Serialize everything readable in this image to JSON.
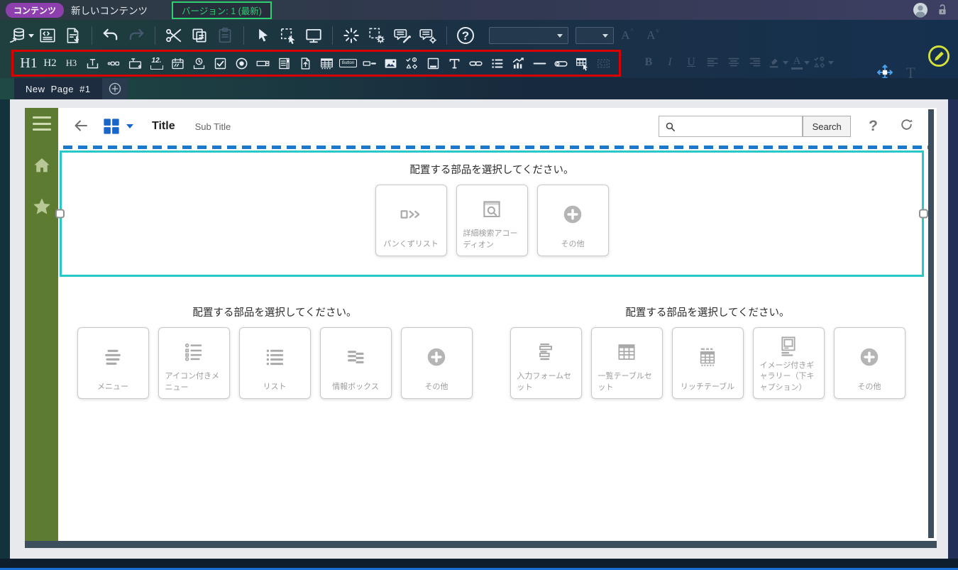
{
  "topbar": {
    "content_badge": "コンテンツ",
    "document_title": "新しいコンテンツ",
    "version_badge": "バージョン: 1 (最新)"
  },
  "toolbar": {
    "help_glyph": "?",
    "font_increase_letter": "A",
    "font_decrease_letter": "A",
    "move_tool_letter": "T"
  },
  "component_palette": {
    "h1": "H1",
    "h2": "H2",
    "h3": "H3",
    "number_label": "12.",
    "button_label": "Button",
    "text_letter": "T"
  },
  "formatting": {
    "bold": "B",
    "italic": "I",
    "underline": "U",
    "font_color_letter": "A"
  },
  "tabbar": {
    "page_tab_label": "New Page #1"
  },
  "page_header": {
    "title": "Title",
    "subtitle": "Sub Title",
    "search_placeholder": "",
    "search_button_label": "Search",
    "help_glyph": "?"
  },
  "placement_prompt": "配置する部品を選択してください。",
  "sections": {
    "hero": {
      "cards": [
        {
          "label": "パンくずリスト"
        },
        {
          "label": "詳細検索アコーディオン"
        },
        {
          "label": "その他"
        }
      ]
    },
    "left": {
      "cards": [
        {
          "label": "メニュー"
        },
        {
          "label": "アイコン付きメニュー"
        },
        {
          "label": "リスト"
        },
        {
          "label": "情報ボックス"
        },
        {
          "label": "その他"
        }
      ]
    },
    "right": {
      "cards": [
        {
          "label": "入力フォームセット"
        },
        {
          "label": "一覧テーブルセット"
        },
        {
          "label": "リッチテーブル"
        },
        {
          "label": "イメージ付きギャラリー（下キャプション）"
        },
        {
          "label": "その他"
        }
      ]
    }
  },
  "colors": {
    "selection_teal": "#28c8c8",
    "drop_indicator_blue": "#1b79cd",
    "palette_outline_red": "#d90000",
    "sidebar_green": "#5d7b31",
    "badge_purple": "#8e3fae",
    "version_green": "#2dcf70",
    "grid_blue": "#1966c9",
    "edit_pencil_yellow": "#d6e03a"
  }
}
